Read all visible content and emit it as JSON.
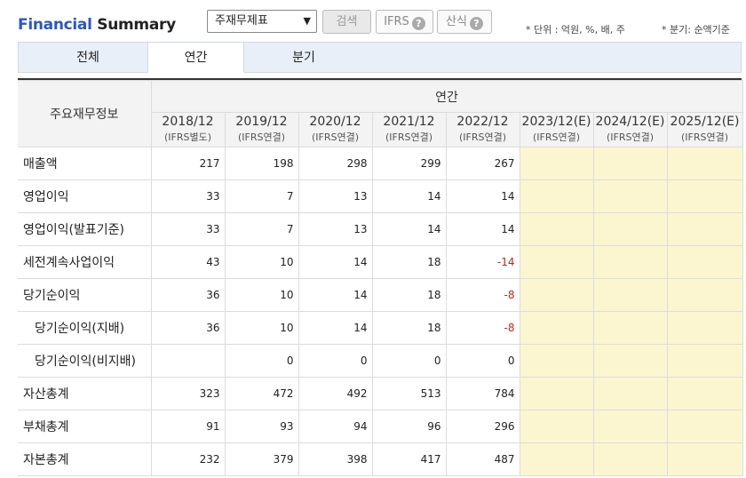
{
  "header": {
    "title_part1": "Financial",
    "title_part2": "Summary",
    "select_value": "주재무제표",
    "search_label": "검색",
    "ifrs_label": "IFRS",
    "formula_label": "산식",
    "help_glyph": "?",
    "unit_note": "* 단위 : 억원, %, 배, 주",
    "quarter_note": "* 분기: 순액기준"
  },
  "tabs": [
    {
      "label": "전체"
    },
    {
      "label": "연간"
    },
    {
      "label": "분기"
    }
  ],
  "table": {
    "row_header": "주요재무정보",
    "group_header": "연간",
    "columns": [
      {
        "year": "2018/12",
        "basis": "(IFRS별도)"
      },
      {
        "year": "2019/12",
        "basis": "(IFRS연결)"
      },
      {
        "year": "2020/12",
        "basis": "(IFRS연결)"
      },
      {
        "year": "2021/12",
        "basis": "(IFRS연결)"
      },
      {
        "year": "2022/12",
        "basis": "(IFRS연결)"
      },
      {
        "year": "2023/12(E)",
        "basis": "(IFRS연결)"
      },
      {
        "year": "2024/12(E)",
        "basis": "(IFRS연결)"
      },
      {
        "year": "2025/12(E)",
        "basis": "(IFRS연결)"
      }
    ],
    "rows": [
      {
        "label": "매출액",
        "values": [
          "217",
          "198",
          "298",
          "299",
          "267"
        ]
      },
      {
        "label": "영업이익",
        "values": [
          "33",
          "7",
          "13",
          "14",
          "14"
        ]
      },
      {
        "label": "영업이익(발표기준)",
        "values": [
          "33",
          "7",
          "13",
          "14",
          "14"
        ]
      },
      {
        "label": "세전계속사업이익",
        "values": [
          "43",
          "10",
          "14",
          "18",
          "-14"
        ]
      },
      {
        "label": "당기순이익",
        "values": [
          "36",
          "10",
          "14",
          "18",
          "-8"
        ]
      },
      {
        "label": "당기순이익(지배)",
        "values": [
          "36",
          "10",
          "14",
          "18",
          "-8"
        ]
      },
      {
        "label": "당기순이익(비지배)",
        "values": [
          "",
          "0",
          "0",
          "0",
          "0"
        ]
      },
      {
        "label": "자산총계",
        "values": [
          "323",
          "472",
          "492",
          "513",
          "784"
        ]
      },
      {
        "label": "부채총계",
        "values": [
          "91",
          "93",
          "94",
          "96",
          "296"
        ]
      },
      {
        "label": "자본총계",
        "values": [
          "232",
          "379",
          "398",
          "417",
          "487"
        ]
      }
    ]
  }
}
